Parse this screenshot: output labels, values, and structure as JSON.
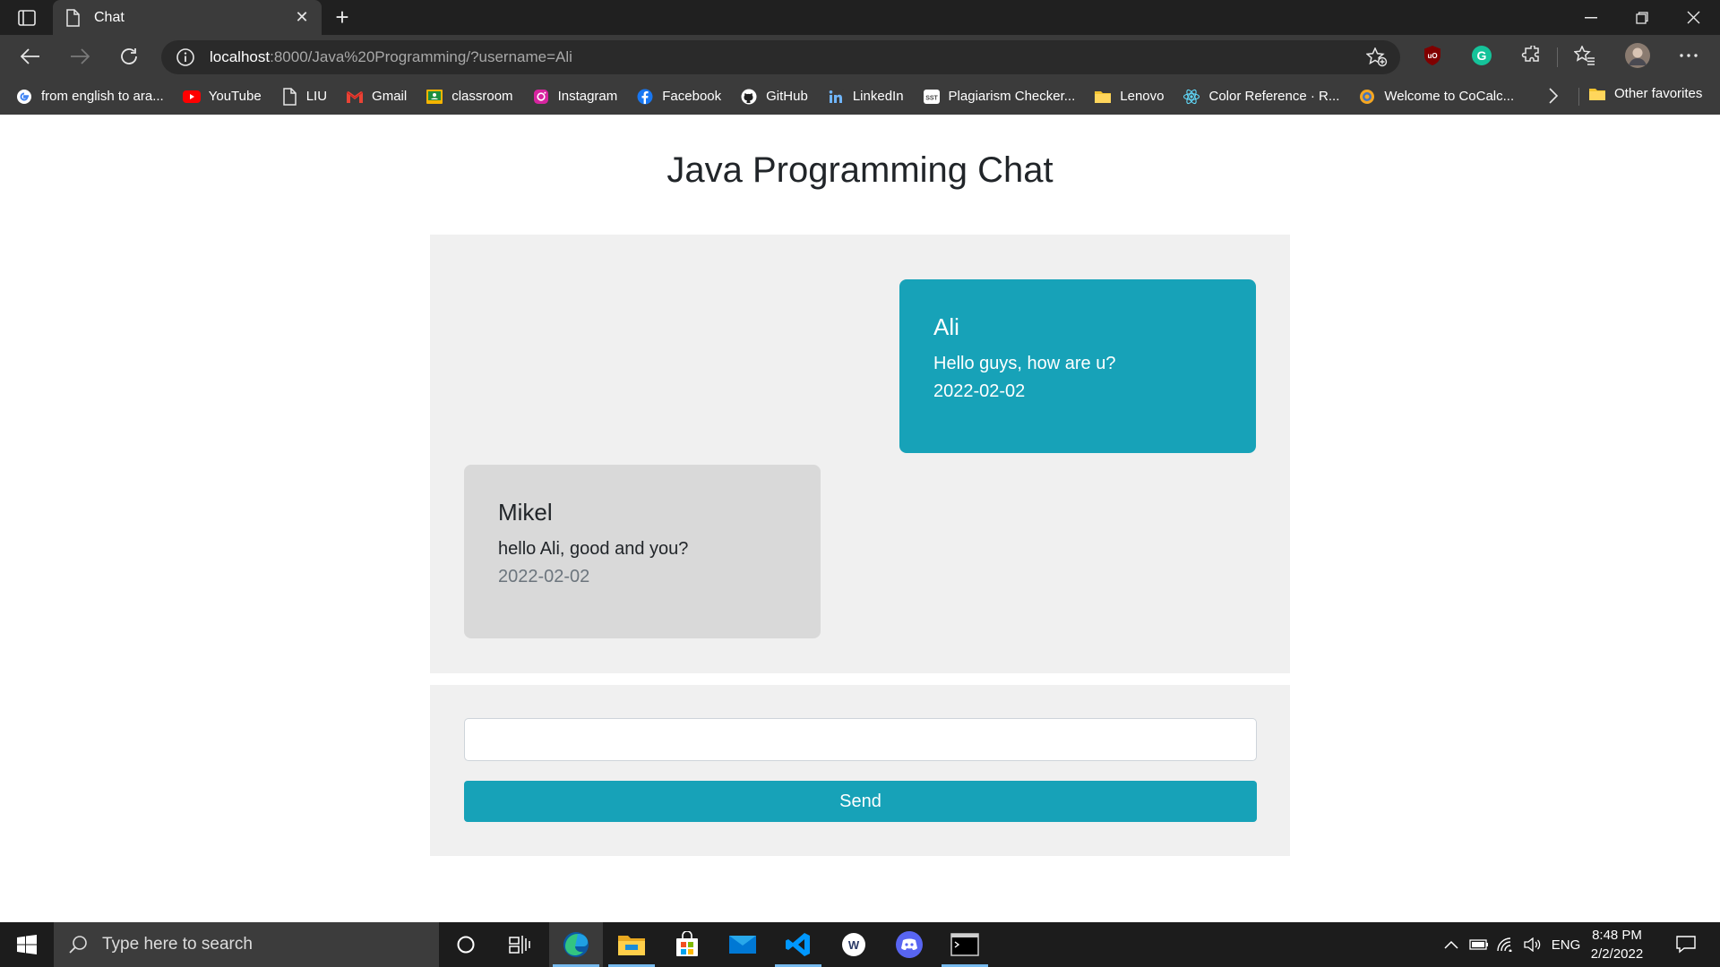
{
  "browser": {
    "tab_title": "Chat",
    "new_tab": "+",
    "url_host": "localhost",
    "url_rest": ":8000/Java%20Programming/?username=Ali",
    "bookmarks": [
      {
        "label": "from english to ara...",
        "icon": "google-icon"
      },
      {
        "label": "YouTube",
        "icon": "youtube-icon"
      },
      {
        "label": "LIU",
        "icon": "page-icon"
      },
      {
        "label": "Gmail",
        "icon": "gmail-icon"
      },
      {
        "label": "classroom",
        "icon": "classroom-icon"
      },
      {
        "label": "Instagram",
        "icon": "instagram-icon"
      },
      {
        "label": "Facebook",
        "icon": "facebook-icon"
      },
      {
        "label": "GitHub",
        "icon": "github-icon"
      },
      {
        "label": "LinkedIn",
        "icon": "linkedin-icon"
      },
      {
        "label": "Plagiarism Checker...",
        "icon": "sst-icon"
      },
      {
        "label": "Lenovo",
        "icon": "folder-icon"
      },
      {
        "label": "Color Reference · R...",
        "icon": "react-icon"
      },
      {
        "label": "Welcome to CoCalc...",
        "icon": "cocalc-icon"
      }
    ],
    "other_favorites": "Other favorites"
  },
  "page": {
    "title": "Java Programming Chat",
    "messages": [
      {
        "user": "Ali",
        "text": "Hello guys, how are u?",
        "date": "2022-02-02",
        "mine": true
      },
      {
        "user": "Mikel",
        "text": "hello Ali, good and you?",
        "date": "2022-02-02",
        "mine": false
      }
    ],
    "input_value": "",
    "send_label": "Send"
  },
  "taskbar": {
    "search_placeholder": "Type here to search",
    "language": "ENG",
    "time": "8:48 PM",
    "date": "2/2/2022"
  },
  "colors": {
    "accent": "#17a2b8",
    "bubble_other": "#d9d9d9",
    "panel": "#f0f0f0"
  }
}
